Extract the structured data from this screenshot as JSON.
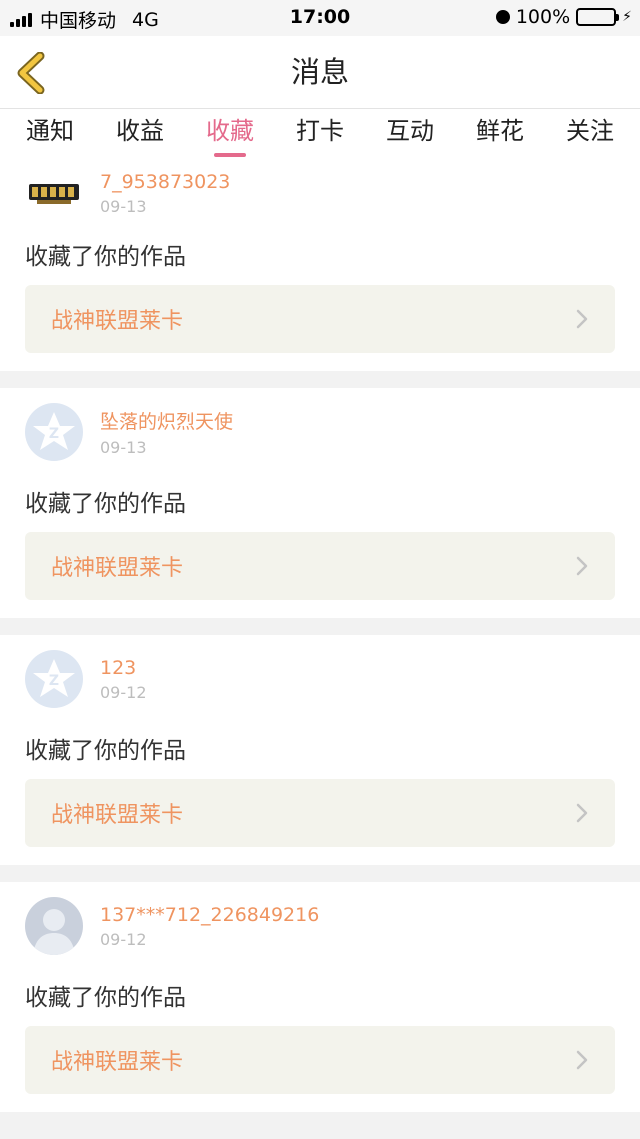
{
  "status_bar": {
    "carrier": "中国移动",
    "network": "4G",
    "time": "17:00",
    "battery": "100%"
  },
  "navbar": {
    "title": "消息"
  },
  "tabs": [
    {
      "label": "通知",
      "active": false
    },
    {
      "label": "收益",
      "active": false
    },
    {
      "label": "收藏",
      "active": true
    },
    {
      "label": "打卡",
      "active": false
    },
    {
      "label": "互动",
      "active": false
    },
    {
      "label": "鲜花",
      "active": false
    },
    {
      "label": "关注",
      "active": false
    }
  ],
  "messages": [
    {
      "user": "7_953873023",
      "date": "09-13",
      "action": "收藏了你的作品",
      "work": "战神联盟莱卡",
      "avatar": "game-logo"
    },
    {
      "user": "坠落的炽烈天使",
      "date": "09-13",
      "action": "收藏了你的作品",
      "work": "战神联盟莱卡",
      "avatar": "qq-default"
    },
    {
      "user": "123",
      "date": "09-12",
      "action": "收藏了你的作品",
      "work": "战神联盟莱卡",
      "avatar": "qq-default"
    },
    {
      "user": "137***712_226849216",
      "date": "09-12",
      "action": "收藏了你的作品",
      "work": "战神联盟莱卡",
      "avatar": "person-default"
    }
  ],
  "colors": {
    "accent": "#e46a8c",
    "username": "#ef9460",
    "back_arrow": "#f2c640"
  }
}
